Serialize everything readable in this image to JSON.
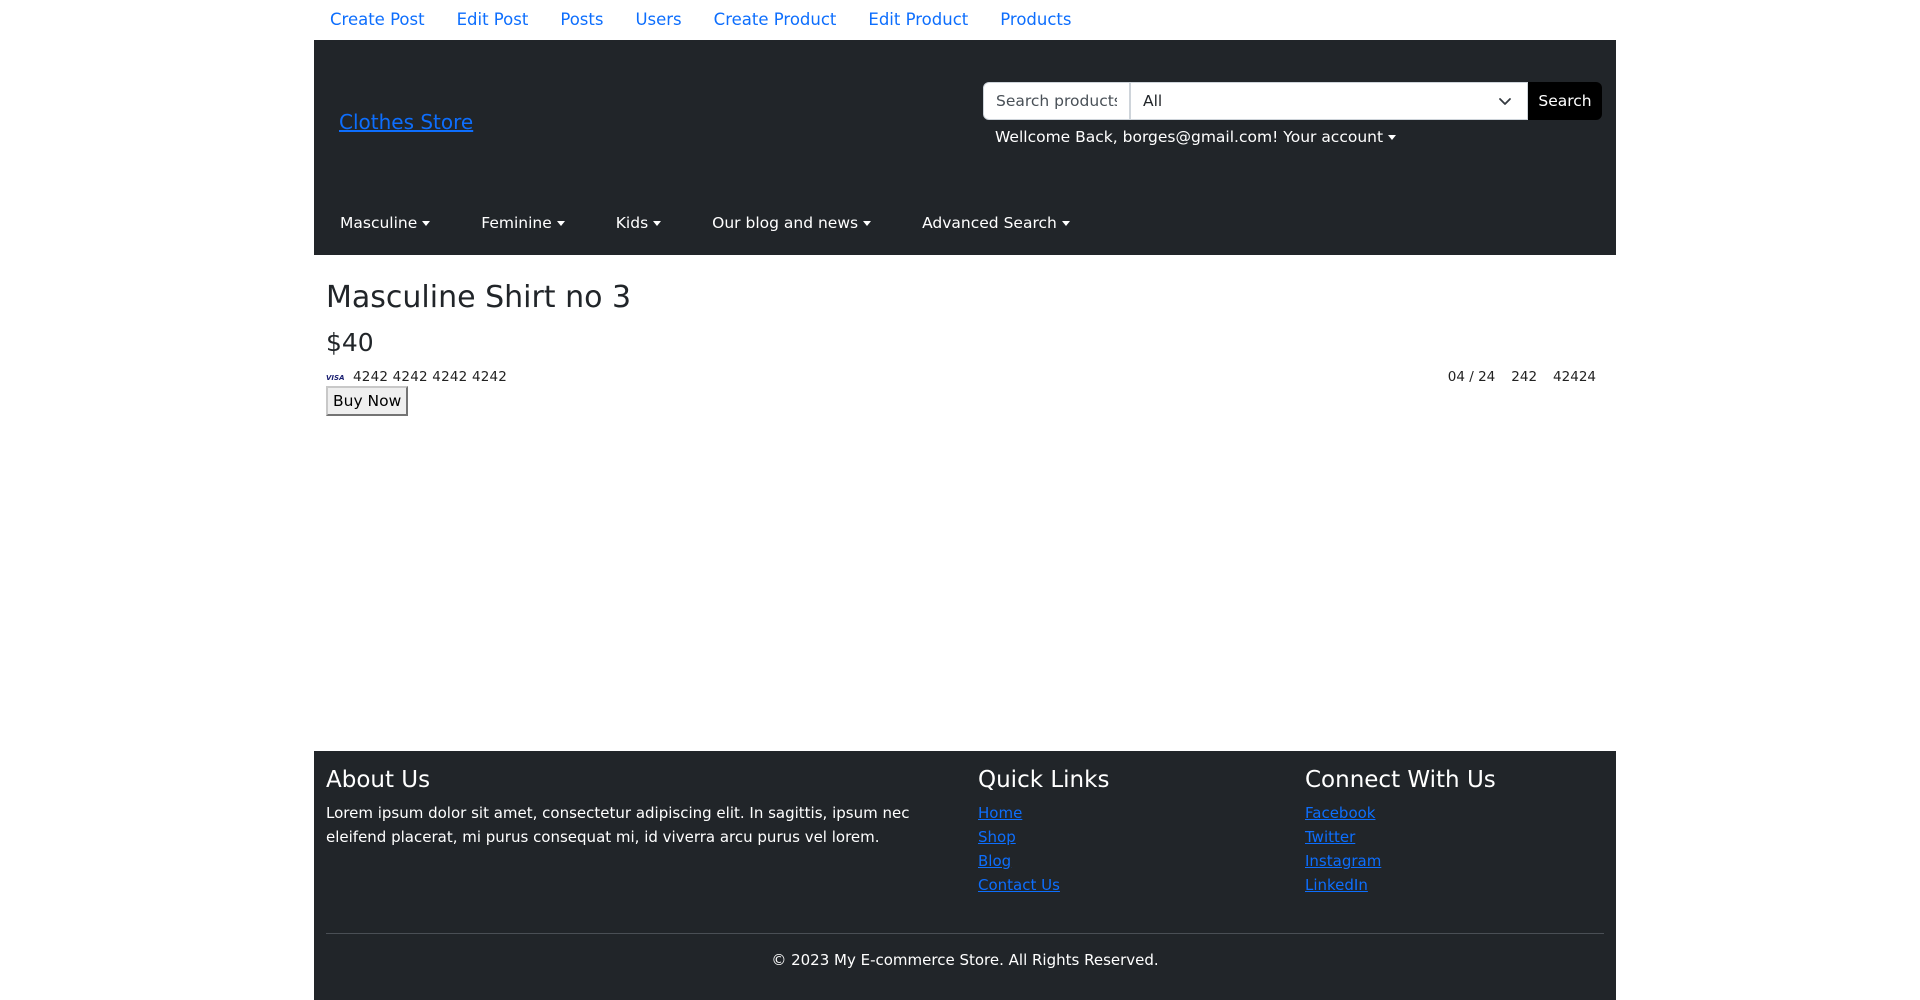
{
  "topnav": {
    "links": [
      "Create Post",
      "Edit Post",
      "Posts",
      "Users",
      "Create Product",
      "Edit Product",
      "Products"
    ]
  },
  "header": {
    "brand": "Clothes Store",
    "search": {
      "placeholder": "Search products.",
      "category_selected": "All",
      "button_label": "Search"
    },
    "welcome_text": "Wellcome Back, borges@gmail.com!",
    "account_label": "Your account",
    "categories": [
      "Masculine",
      "Feminine",
      "Kids",
      "Our blog and news",
      "Advanced Search"
    ],
    "background_color": "#212529"
  },
  "product": {
    "title": "Masculine Shirt no 3",
    "price": "$40",
    "card": {
      "brand_icon": "visa-icon",
      "number": "4242 4242 4242 4242",
      "expiry": "04 / 24",
      "cvc": "242",
      "zip": "42424"
    },
    "buy_label": "Buy Now"
  },
  "footer": {
    "about_title": "About Us",
    "about_text": "Lorem ipsum dolor sit amet, consectetur adipiscing elit. In sagittis, ipsum nec eleifend placerat, mi purus consequat mi, id viverra arcu purus vel lorem.",
    "quick_title": "Quick Links",
    "quick_links": [
      "Home",
      "Shop",
      "Blog",
      "Contact Us"
    ],
    "connect_title": "Connect With Us",
    "connect_links": [
      "Facebook",
      "Twitter",
      "Instagram",
      "LinkedIn"
    ],
    "copyright": "© 2023 My E-commerce Store. All Rights Reserved."
  },
  "colors": {
    "link": "#0d6efd",
    "dark": "#212529"
  }
}
